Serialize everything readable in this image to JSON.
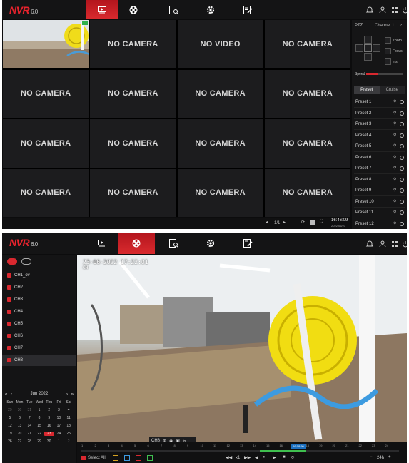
{
  "app": {
    "logo": "NVR",
    "version": "6.0"
  },
  "live": {
    "cells": [
      {
        "label": ""
      },
      {
        "label": "NO CAMERA"
      },
      {
        "label": "NO VIDEO"
      },
      {
        "label": "NO CAMERA"
      },
      {
        "label": "NO CAMERA"
      },
      {
        "label": "NO CAMERA"
      },
      {
        "label": "NO CAMERA"
      },
      {
        "label": "NO CAMERA"
      },
      {
        "label": "NO CAMERA"
      },
      {
        "label": "NO CAMERA"
      },
      {
        "label": "NO CAMERA"
      },
      {
        "label": "NO CAMERA"
      },
      {
        "label": "NO CAMERA"
      },
      {
        "label": "NO CAMERA"
      },
      {
        "label": "NO CAMERA"
      },
      {
        "label": "NO CAMERA"
      }
    ],
    "page": "1/1",
    "time": "16:46:09",
    "date": "2022/06/23"
  },
  "ptz": {
    "title": "PTZ",
    "channel": "Channel 1",
    "zoom": "Zoom",
    "focus": "Focus",
    "iris": "Iris",
    "speed": "Speed",
    "speed_level": 0.3,
    "tabs": [
      "Preset",
      "Cruise"
    ],
    "presets": [
      "Preset 1",
      "Preset 2",
      "Preset 3",
      "Preset 4",
      "Preset 5",
      "Preset 6",
      "Preset 7",
      "Preset 8",
      "Preset 9",
      "Preset 10",
      "Preset 11",
      "Preset 12"
    ]
  },
  "playback": {
    "channels": [
      "CH1_ov",
      "CH2",
      "CH3",
      "CH4",
      "CH5",
      "CH6",
      "CH7",
      "CH8"
    ],
    "selected_channel": "CH8",
    "month": "Jun 2022",
    "weekdays": [
      "Sun",
      "Mon",
      "Tue",
      "Wed",
      "Thu",
      "Fri",
      "Sat"
    ],
    "days": [
      [
        "29",
        "30",
        "31",
        "1",
        "2",
        "3",
        "4"
      ],
      [
        "5",
        "6",
        "7",
        "8",
        "9",
        "10",
        "11"
      ],
      [
        "12",
        "13",
        "14",
        "15",
        "16",
        "17",
        "18"
      ],
      [
        "19",
        "20",
        "21",
        "22",
        "23",
        "24",
        "25"
      ],
      [
        "26",
        "27",
        "28",
        "29",
        "30",
        "1",
        "2"
      ]
    ],
    "today": "23",
    "osd_time": "23-06-2022 17:22:01",
    "osd_cam": "CH",
    "tool_channel": "CH8",
    "cursor_time": "16:18:50",
    "select_all": "Select All",
    "speed": "x1",
    "timeline_scale": "24h",
    "hours": [
      "1",
      "2",
      "3",
      "4",
      "5",
      "6",
      "7",
      "8",
      "9",
      "10",
      "11",
      "12",
      "13",
      "14",
      "15",
      "16",
      "17",
      "18",
      "19",
      "20",
      "21",
      "22",
      "23",
      "24"
    ]
  },
  "colors": {
    "accent": "#d9282f",
    "bg": "#0c0c0d"
  }
}
